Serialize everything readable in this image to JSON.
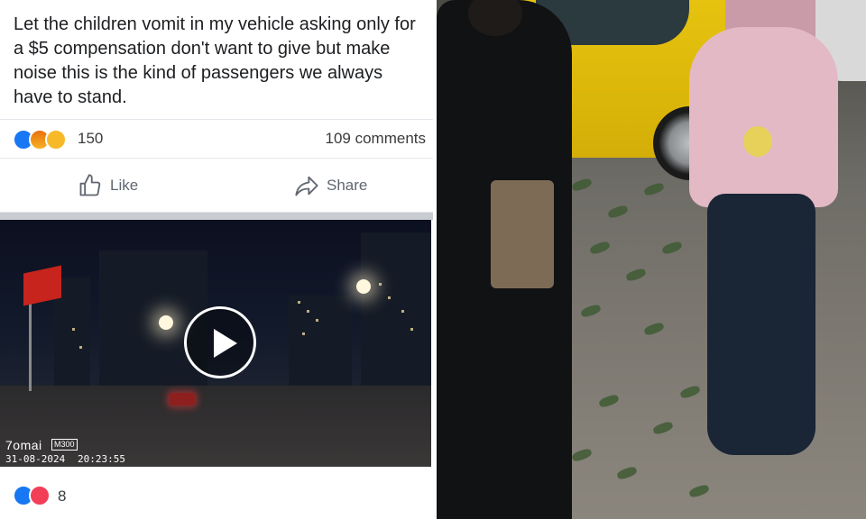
{
  "post": {
    "text": "Let the children vomit in my vehicle asking only for a $5 compensation don't want to give but make noise this is the kind of passengers we always have to stand.",
    "reactions": {
      "icons": [
        "like-icon",
        "angry-icon",
        "sad-icon"
      ],
      "count": "150",
      "comments": "109 comments"
    },
    "actions": {
      "like_label": "Like",
      "share_label": "Share"
    }
  },
  "video": {
    "cam_brand": "7omai",
    "cam_model": "M300",
    "date": "31-08-2024",
    "time": "20:23:55",
    "reactions": {
      "icons": [
        "like-icon",
        "love-icon"
      ],
      "count": "8"
    }
  },
  "colors": {
    "facebook_blue": "#1877f2",
    "text": "#1c1e21",
    "muted": "#606770",
    "taxi_yellow": "#e6c30f"
  }
}
